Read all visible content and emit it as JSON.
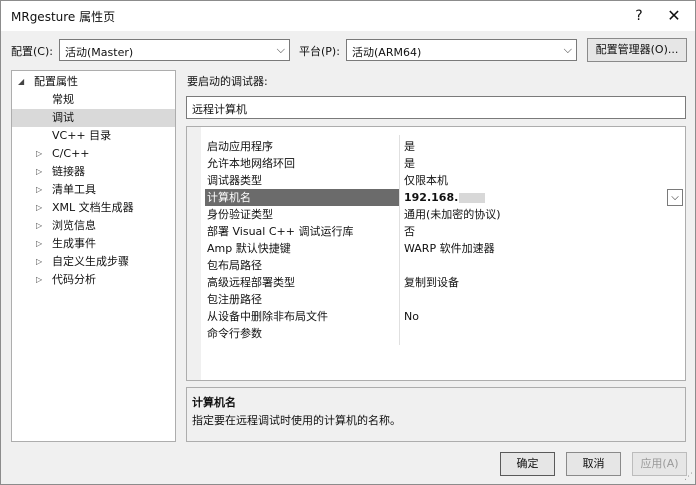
{
  "window": {
    "title": "MRgesture 属性页",
    "help": "?",
    "close": "✕"
  },
  "config_row": {
    "config_label": "配置(C):",
    "config_value": "活动(Master)",
    "platform_label": "平台(P):",
    "platform_value": "活动(ARM64)",
    "manager_button": "配置管理器(O)..."
  },
  "tree": {
    "root": "配置属性",
    "items": [
      {
        "label": "常规",
        "expandable": false,
        "selected": false
      },
      {
        "label": "调试",
        "expandable": false,
        "selected": true
      },
      {
        "label": "VC++ 目录",
        "expandable": false,
        "selected": false
      },
      {
        "label": "C/C++",
        "expandable": true,
        "selected": false
      },
      {
        "label": "链接器",
        "expandable": true,
        "selected": false
      },
      {
        "label": "清单工具",
        "expandable": true,
        "selected": false
      },
      {
        "label": "XML 文档生成器",
        "expandable": true,
        "selected": false
      },
      {
        "label": "浏览信息",
        "expandable": true,
        "selected": false
      },
      {
        "label": "生成事件",
        "expandable": true,
        "selected": false
      },
      {
        "label": "自定义生成步骤",
        "expandable": true,
        "selected": false
      },
      {
        "label": "代码分析",
        "expandable": true,
        "selected": false
      }
    ]
  },
  "debugger": {
    "label": "要启动的调试器:",
    "value": "远程计算机"
  },
  "properties": [
    {
      "key": "启动应用程序",
      "value": "是"
    },
    {
      "key": "允许本地网络环回",
      "value": "是"
    },
    {
      "key": "调试器类型",
      "value": "仅限本机"
    },
    {
      "key": "计算机名",
      "value": "192.168.",
      "selected": true
    },
    {
      "key": "身份验证类型",
      "value": "通用(未加密的协议)"
    },
    {
      "key": "部署 Visual C++ 调试运行库",
      "value": "否"
    },
    {
      "key": "Amp 默认快捷键",
      "value": "WARP 软件加速器"
    },
    {
      "key": "包布局路径",
      "value": ""
    },
    {
      "key": "高级远程部署类型",
      "value": "复制到设备"
    },
    {
      "key": "包注册路径",
      "value": ""
    },
    {
      "key": "从设备中删除非布局文件",
      "value": "No"
    },
    {
      "key": "命令行参数",
      "value": ""
    }
  ],
  "description": {
    "title": "计算机名",
    "text": "指定要在远程调试时使用的计算机的名称。"
  },
  "buttons": {
    "ok": "确定",
    "cancel": "取消",
    "apply": "应用(A)"
  },
  "icons": {
    "chevron": "⌵",
    "expanded_arrow": "◢",
    "collapsed_arrow": "▷"
  }
}
